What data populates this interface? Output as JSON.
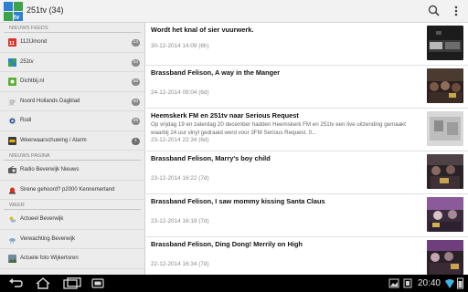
{
  "app": {
    "title": "251tv (34)",
    "icon": "tv-app-icon",
    "colors": {
      "actionbar": "#f2f2f2",
      "sidebar": "#ececec",
      "badge": "#8a8a8a",
      "navbar": "#000000"
    }
  },
  "toolbar": {
    "search_icon": "search-icon",
    "overflow_icon": "overflow-menu-icon"
  },
  "sidebar": {
    "sections": [
      {
        "title": "NIEUWS FEEDS",
        "items": [
          {
            "label": "112IJmond",
            "badge": "13",
            "icon": "112-icon"
          },
          {
            "label": "251tv",
            "badge": "34",
            "icon": "251tv-icon"
          },
          {
            "label": "Dichtbij.nl",
            "badge": "36",
            "icon": "dichtbij-icon"
          },
          {
            "label": "Noord Hollands Dagblad",
            "badge": "40",
            "icon": "nhd-icon"
          },
          {
            "label": "Rodi",
            "badge": "39",
            "icon": "rodi-icon"
          },
          {
            "label": "Weerwaarschuwing / Alarm",
            "badge": "1",
            "icon": "weather-alarm-icon"
          }
        ]
      },
      {
        "title": "NIEUWS PAGINA",
        "items": [
          {
            "label": "Radio Beverwijk Nieuws",
            "icon": "radio-icon"
          },
          {
            "label": "Sirene gehoord? p2000 Kennemerland",
            "icon": "siren-icon"
          }
        ]
      },
      {
        "title": "WEER",
        "items": [
          {
            "label": "Actueel Beverwijk",
            "icon": "weather-current-icon"
          },
          {
            "label": "Verwachting Beverwijk",
            "icon": "weather-forecast-icon"
          },
          {
            "label": "Actuele foto Wijkertoren",
            "icon": "photo-icon"
          }
        ]
      }
    ]
  },
  "feed": [
    {
      "title": "Wordt het knal of sier vuurwerk.",
      "excerpt": "",
      "date": "30-12-2014 14:09 (6h)"
    },
    {
      "title": "Brassband Felison, A way in the Manger",
      "excerpt": "",
      "date": "24-12-2014 09:04 (6d)"
    },
    {
      "title": "Heemskerk FM en 251tv naar Serious Request",
      "excerpt": "Op vrijdag 19 en zaterdag 20 december hadden Heemskerk FM en 251tv een live uitzending gemaakt waarbij 24 uur vinyl gedraaid werd voor 3FM Serious Request. 0...",
      "date": "23-12-2014 22:34 (6d)"
    },
    {
      "title": "Brassband Felison, Marry's boy child",
      "excerpt": "",
      "date": "23-12-2014 16:22 (7d)"
    },
    {
      "title": "Brassband Felison, I saw mommy kissing Santa Claus",
      "excerpt": "",
      "date": "23-12-2014 16:19 (7d)"
    },
    {
      "title": "Brassband Felison, Ding Dong! Merrily on High",
      "excerpt": "",
      "date": "22-12-2014 16:34 (7d)"
    }
  ],
  "navbar": {
    "back_icon": "back-icon",
    "home_icon": "home-icon",
    "recents_icon": "recent-apps-icon",
    "status_icons": [
      "gallery-icon",
      "screenshot-icon",
      "wifi-icon",
      "battery-icon"
    ],
    "time": "20:40"
  }
}
